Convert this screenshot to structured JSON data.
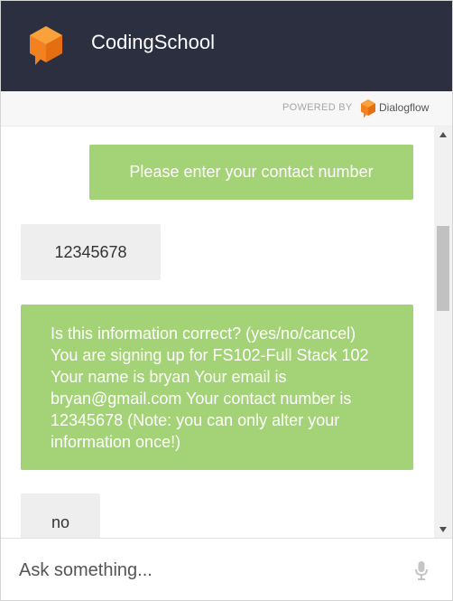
{
  "header": {
    "agent_name": "CodingSchool"
  },
  "powered_by": {
    "label": "POWERED BY",
    "brand": "Dialogflow"
  },
  "messages": [
    {
      "from": "user",
      "text": "Please enter your contact number"
    },
    {
      "from": "agent",
      "text": "12345678"
    },
    {
      "from": "user",
      "text": "Is this information correct? (yes/no/cancel) You are signing up for FS102-Full Stack 102 Your name is bryan Your email is bryan@gmail.com Your contact number is 12345678 (Note: you can only alter your information once!)"
    },
    {
      "from": "agent",
      "text": "no"
    }
  ],
  "input": {
    "placeholder": "Ask something...",
    "value": ""
  },
  "icons": {
    "agent_logo": "orange-cube-icon",
    "brand_logo": "dialogflow-logo-icon",
    "mic": "microphone-icon",
    "scroll_up": "scroll-up-arrow-icon",
    "scroll_down": "scroll-down-arrow-icon"
  },
  "colors": {
    "header_bg": "#2b2f3f",
    "user_bubble": "#a4d276",
    "agent_bubble": "#eeeeee",
    "accent_orange": "#f5821f"
  }
}
